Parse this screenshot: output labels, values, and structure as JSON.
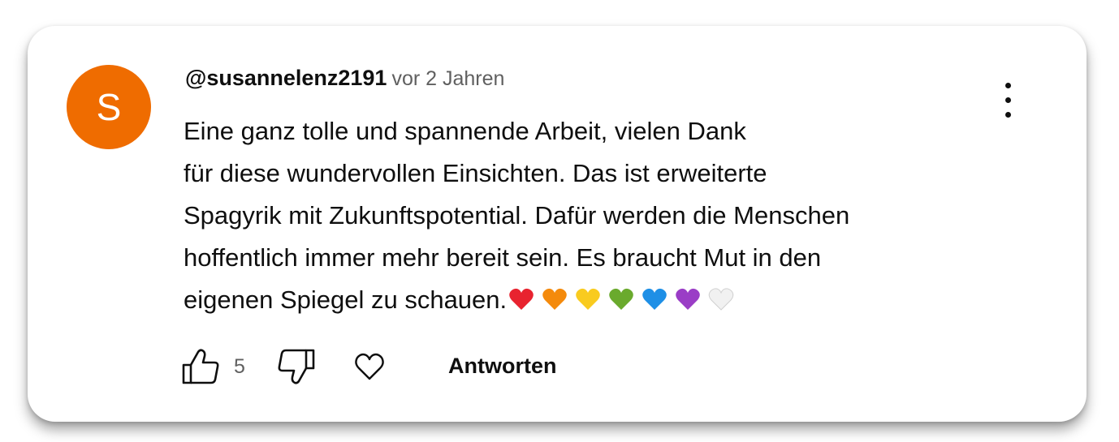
{
  "comment": {
    "avatar_letter": "S",
    "avatar_color": "#ef6c00",
    "author": "@susannelenz2191",
    "timestamp": "vor 2 Jahren",
    "text_lines": [
      "Eine ganz tolle und spannende Arbeit, vielen Dank",
      "für diese wundervollen Einsichten. Das ist erweiterte",
      "Spagyrik mit Zukunftspotential. Dafür werden die Menschen",
      "hoffentlich immer mehr bereit sein. Es braucht Mut in den",
      "eigenen Spiegel zu schauen."
    ],
    "hearts": [
      {
        "name": "red-heart-icon",
        "color": "#e8232f"
      },
      {
        "name": "orange-heart-icon",
        "color": "#f48a0c"
      },
      {
        "name": "yellow-heart-icon",
        "color": "#f9cb1f"
      },
      {
        "name": "green-heart-icon",
        "color": "#6aaa2d"
      },
      {
        "name": "blue-heart-icon",
        "color": "#1e8fe6"
      },
      {
        "name": "purple-heart-icon",
        "color": "#9a3dc6"
      },
      {
        "name": "white-heart-icon",
        "color": "#f1f1f1"
      }
    ]
  },
  "actions": {
    "like_icon": "thumbs-up-icon",
    "like_count": "5",
    "dislike_icon": "thumbs-down-icon",
    "heart_icon": "heart-outline-icon",
    "reply_label": "Antworten"
  },
  "menu": {
    "icon": "more-vertical-icon"
  }
}
